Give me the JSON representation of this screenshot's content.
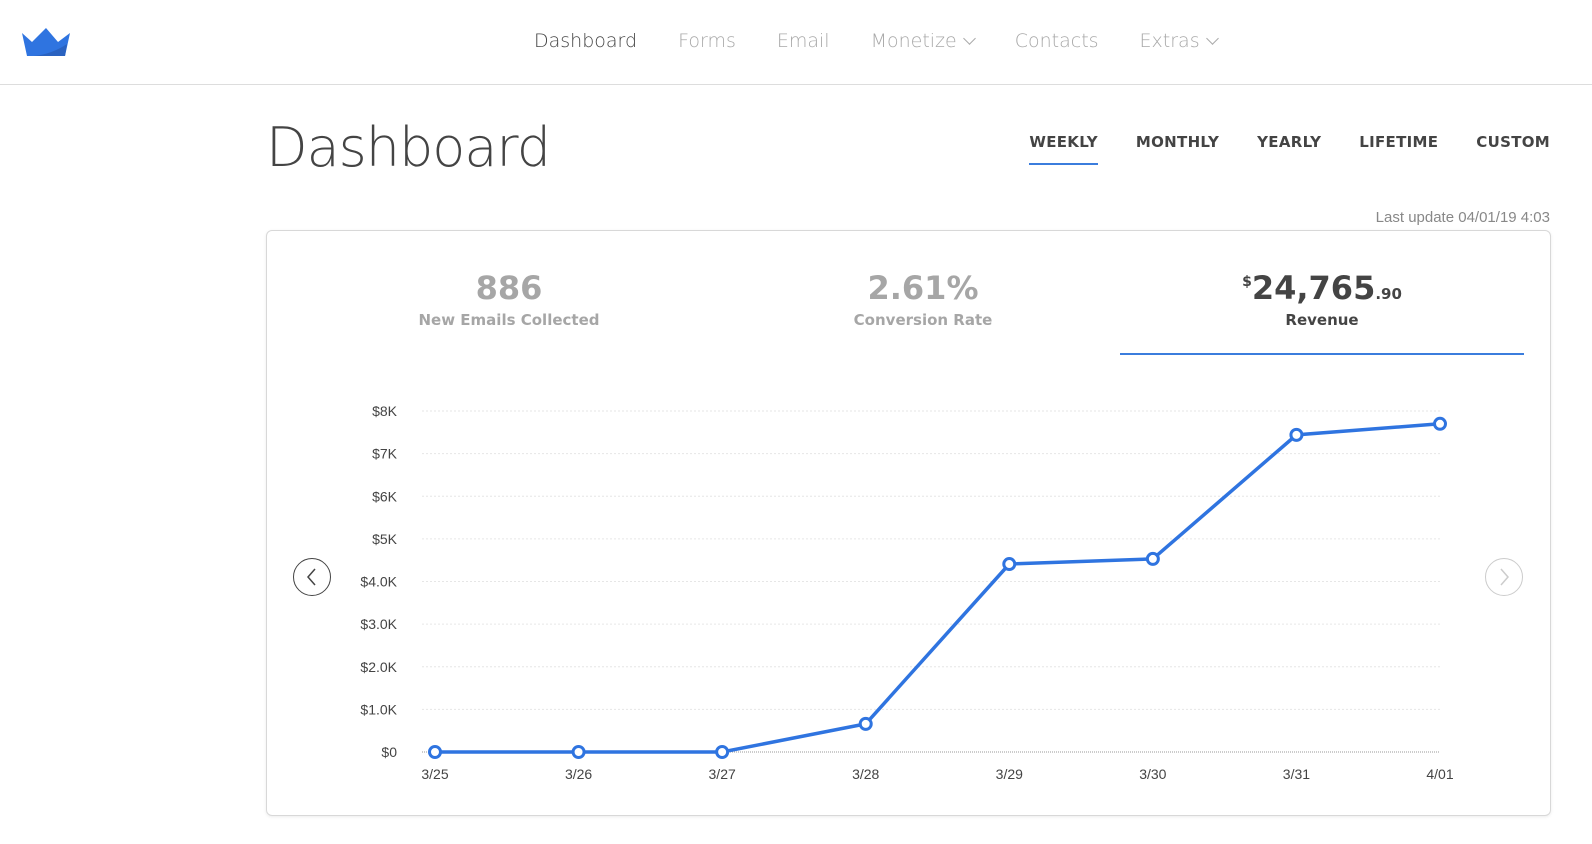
{
  "nav": {
    "items": [
      {
        "label": "Dashboard",
        "active": true,
        "dropdown": false
      },
      {
        "label": "Forms",
        "active": false,
        "dropdown": false
      },
      {
        "label": "Email",
        "active": false,
        "dropdown": false
      },
      {
        "label": "Monetize",
        "active": false,
        "dropdown": true
      },
      {
        "label": "Contacts",
        "active": false,
        "dropdown": false
      },
      {
        "label": "Extras",
        "active": false,
        "dropdown": true
      }
    ]
  },
  "page": {
    "title": "Dashboard",
    "last_update": "Last update 04/01/19 4:03"
  },
  "periods": [
    "WEEKLY",
    "MONTHLY",
    "YEARLY",
    "LIFETIME",
    "CUSTOM"
  ],
  "active_period": "WEEKLY",
  "stats": {
    "emails": {
      "value": "886",
      "label": "New Emails Collected"
    },
    "conversion": {
      "value": "2.61%",
      "label": "Conversion Rate"
    },
    "revenue": {
      "currency": "$",
      "value": "24,765",
      "cents": ".90",
      "label": "Revenue"
    }
  },
  "colors": {
    "accent": "#3b7ddd",
    "line": "#2f74e0"
  },
  "chart_data": {
    "type": "line",
    "categories": [
      "3/25",
      "3/26",
      "3/27",
      "3/28",
      "3/29",
      "3/30",
      "3/31",
      "4/01"
    ],
    "values": [
      0,
      0,
      0,
      660,
      4410,
      4530,
      7440,
      7700
    ],
    "yticks": [
      0,
      1000,
      2000,
      3000,
      4000,
      5000,
      6000,
      7000,
      8000
    ],
    "ytick_labels": [
      "$0",
      "$1.0K",
      "$2.0K",
      "$3.0K",
      "$4.0K",
      "$5K",
      "$6K",
      "$7K",
      "$8K"
    ],
    "ylim": [
      0,
      8000
    ],
    "grid": true
  }
}
